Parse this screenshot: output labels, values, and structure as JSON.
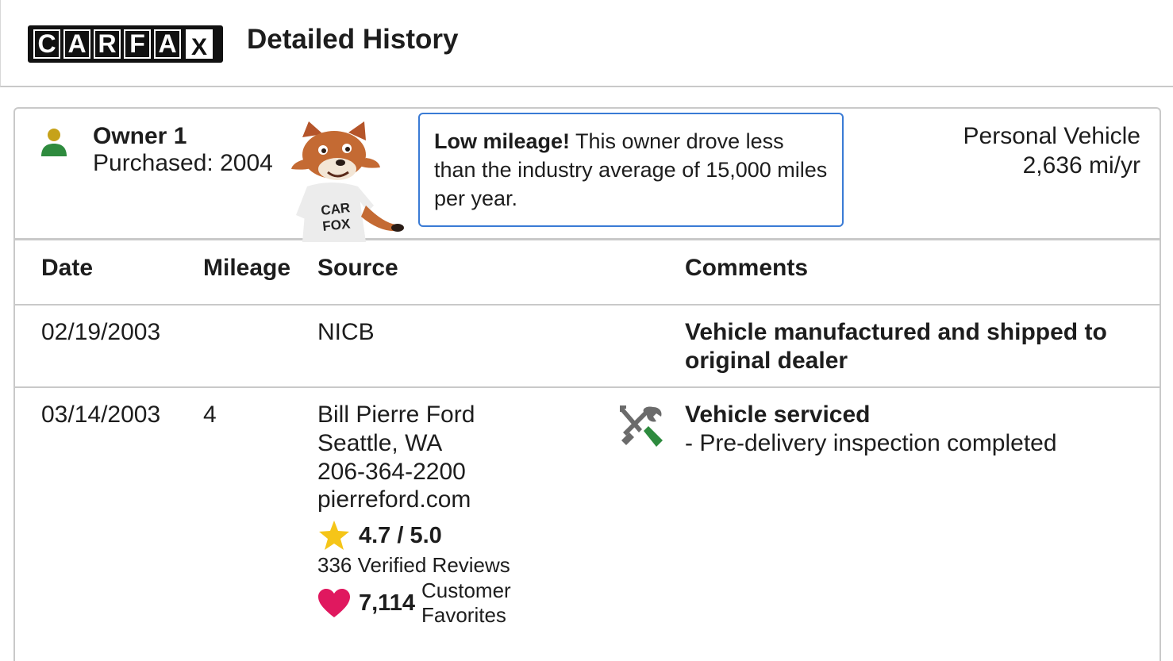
{
  "brand": {
    "logo_letters": [
      "C",
      "A",
      "R",
      "F",
      "A",
      "X"
    ]
  },
  "header": {
    "title": "Detailed History"
  },
  "owner": {
    "name": "Owner 1",
    "purchased": "Purchased: 2004",
    "mascot_shirt": "CAR FOX",
    "callout_bold": "Low mileage!",
    "callout_text": " This owner drove less than the industry average of 15,000 miles per year.",
    "vehicle_type": "Personal Vehicle",
    "mileage_rate": "2,636 mi/yr"
  },
  "table": {
    "columns": [
      "Date",
      "Mileage",
      "Source",
      "Comments"
    ],
    "rows": [
      {
        "date": "02/19/2003",
        "mileage": "",
        "source": "NICB",
        "comment": "Vehicle manufactured and shipped to original dealer"
      },
      {
        "date": "03/14/2003",
        "mileage": "4",
        "source_name": "Bill Pierre Ford",
        "source_city": "Seattle, WA",
        "source_phone": "206-364-2200",
        "source_site": "pierreford.com",
        "rating": "4.7 / 5.0",
        "reviews": "336 Verified Reviews",
        "favorites_count": "7,114",
        "favorites_label": "Customer Favorites",
        "comment": "Vehicle serviced",
        "comment_detail": "- Pre-delivery inspection completed"
      }
    ]
  },
  "colors": {
    "callout_border": "#3a7bd5",
    "person_head": "#c6a21a",
    "person_body": "#2e8b3e",
    "star": "#f5c518",
    "heart": "#e0185f",
    "tool_handle": "#2e8b3e"
  },
  "icons": [
    "person-icon",
    "fox-mascot",
    "tools-icon",
    "star-icon",
    "heart-icon"
  ]
}
